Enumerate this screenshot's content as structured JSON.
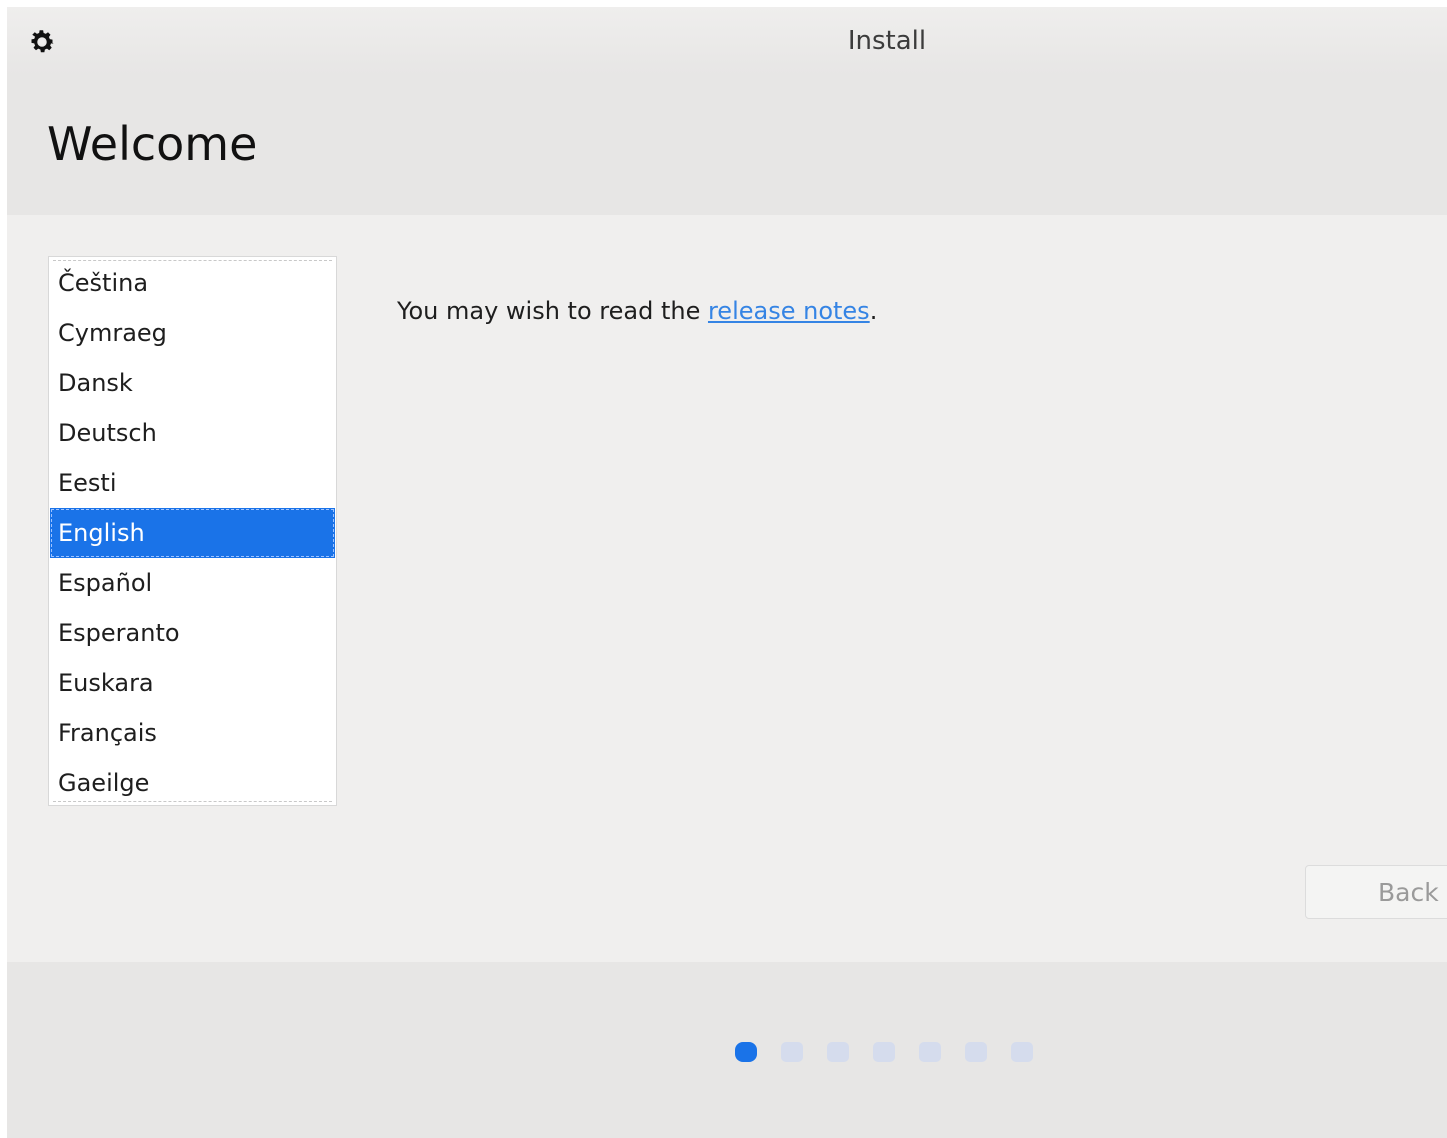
{
  "window": {
    "title": "Install"
  },
  "header": {
    "title": "Welcome"
  },
  "languages": {
    "items": [
      "Čeština",
      "Cymraeg",
      "Dansk",
      "Deutsch",
      "Eesti",
      "English",
      "Español",
      "Esperanto",
      "Euskara",
      "Français",
      "Gaeilge"
    ],
    "selected": "English"
  },
  "release": {
    "prefix": "You may wish to read the ",
    "link_label": "release notes",
    "suffix": "."
  },
  "buttons": {
    "back_label": "Back"
  },
  "progress": {
    "total_steps": 7,
    "current_step": 1
  },
  "icons": {
    "settings": "gear-icon"
  },
  "colors": {
    "accent": "#1a73e8",
    "link": "#3584e4",
    "inactive_dot": "#d5dced"
  }
}
